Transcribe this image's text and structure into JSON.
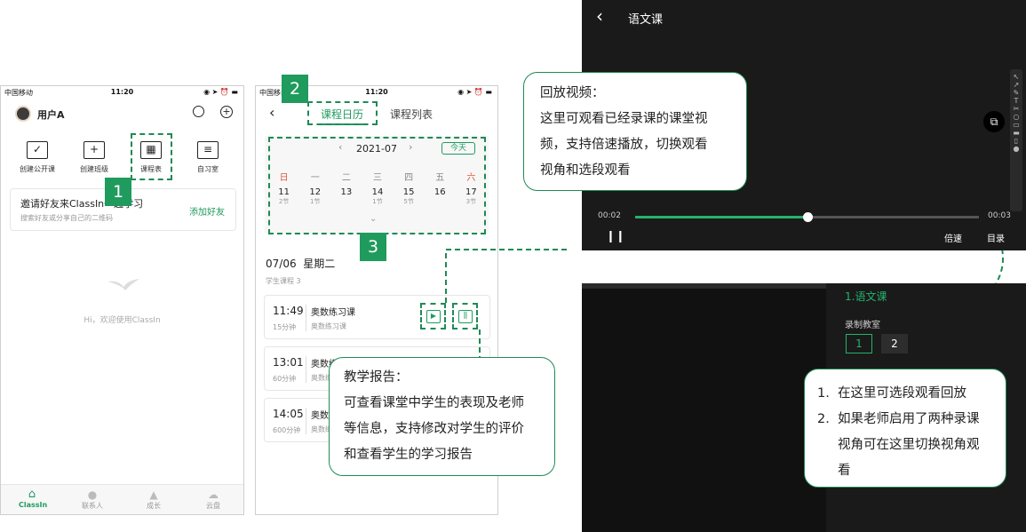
{
  "phone1": {
    "status": {
      "carrier": "中国移动",
      "time": "11:20",
      "battery": "▮"
    },
    "user_name": "用户A",
    "tiles": [
      {
        "label": "创建公开课",
        "icon": "☐✓"
      },
      {
        "label": "创建班级",
        "icon": "+"
      },
      {
        "label": "课程表",
        "icon": "▦"
      },
      {
        "label": "自习室",
        "icon": "≡"
      }
    ],
    "invite": {
      "title": "邀请好友来ClassIn一起学习",
      "subtitle": "搜索好友或分享自己的二维码",
      "action": "添加好友"
    },
    "welcome": "Hi，欢迎使用ClassIn",
    "tabs": [
      "ClassIn",
      "联系人",
      "成长",
      "云盘"
    ]
  },
  "phone2": {
    "status": {
      "carrier": "中国移动",
      "time": "11:20"
    },
    "tabs": [
      "课程日历",
      "课程列表"
    ],
    "month": "2021-07",
    "today_btn": "今天",
    "weekdays": [
      "日",
      "一",
      "二",
      "三",
      "四",
      "五",
      "六"
    ],
    "days": [
      {
        "d": "11",
        "n": "2节"
      },
      {
        "d": "12",
        "n": "1节"
      },
      {
        "d": "13",
        "n": ""
      },
      {
        "d": "14",
        "n": "1节"
      },
      {
        "d": "15",
        "n": "5节"
      },
      {
        "d": "16",
        "n": ""
      },
      {
        "d": "17",
        "n": "3节"
      }
    ],
    "date_heading": "07/06  星期二",
    "student_courses": "学生课程 3",
    "courses": [
      {
        "time": "11:49",
        "dur": "15分钟",
        "title": "奥数练习课",
        "sub": "奥数练习课"
      },
      {
        "time": "13:01",
        "dur": "60分钟",
        "title": "奥数练习课",
        "sub": "奥数练习课"
      },
      {
        "time": "14:05",
        "dur": "600分钟",
        "title": "奥数练习课",
        "sub": "奥数练习课"
      }
    ]
  },
  "badges": [
    "1",
    "2",
    "3"
  ],
  "player": {
    "title": "语文课",
    "current": "00:02",
    "total": "00:03",
    "speed": "倍速",
    "catalog": "目录",
    "progress": 0.5
  },
  "catalog_panel": {
    "title": "1.语文课",
    "room_label": "录制教室",
    "rooms": [
      "1",
      "2"
    ]
  },
  "callouts": {
    "playback": {
      "title": "回放视频：",
      "lines": [
        "这里可观看已经录课的课堂视",
        "频，支持倍速播放，切换观看",
        "视角和选段观看"
      ]
    },
    "report": {
      "title": "教学报告：",
      "lines": [
        "可查看课堂中学生的表现及老师",
        "等信息，支持修改对学生的评价",
        "和查看学生的学习报告"
      ]
    },
    "segments": {
      "items": [
        "1.  在这里可选段观看回放",
        "2.  如果老师启用了两种录课",
        "视角可在这里切换视角观",
        "看"
      ]
    }
  },
  "colors": {
    "accent": "#1f9b5d",
    "dark": "#141414"
  }
}
